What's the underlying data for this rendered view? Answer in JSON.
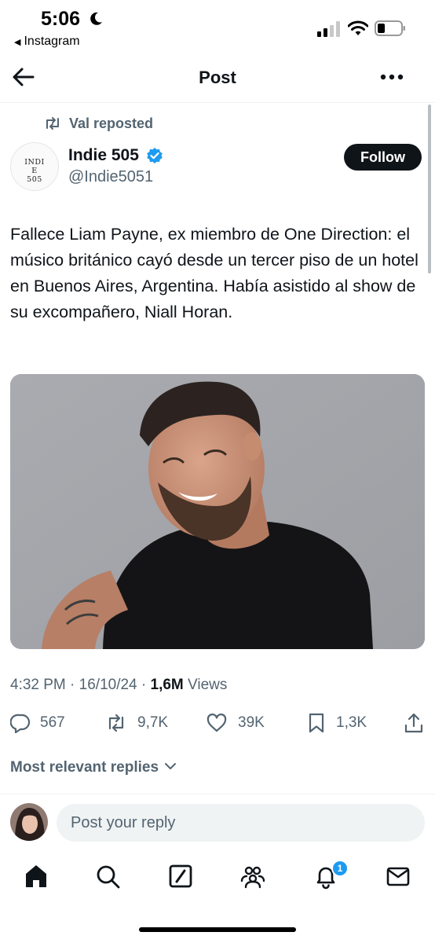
{
  "status_bar": {
    "time": "5:06",
    "back_app": "Instagram"
  },
  "header": {
    "title": "Post"
  },
  "repost": {
    "text": "Val reposted"
  },
  "author": {
    "avatar_logo_text": "INDIE 505",
    "name": "Indie 505",
    "handle": "@Indie5051",
    "follow_label": "Follow"
  },
  "tweet": {
    "text": "Fallece Liam Payne, ex miembro de One Direction: el músico británico cayó desde un tercer piso de un hotel en Buenos Aires, Argentina. Había asistido al show de su excompañero, Niall Horan."
  },
  "meta": {
    "time": "4:32 PM",
    "date": "16/10/24",
    "views_count": "1,6M",
    "views_label": "Views"
  },
  "actions": {
    "replies": "567",
    "reposts": "9,7K",
    "likes": "39K",
    "bookmarks": "1,3K"
  },
  "replies_sort": "Most relevant replies",
  "composer": {
    "placeholder": "Post your reply"
  },
  "tabbar": {
    "notifications_badge": "1"
  },
  "colors": {
    "accent": "#1d9bf0",
    "text_primary": "#0f1419",
    "text_secondary": "#536471",
    "follow_bg": "#0f1419",
    "input_bg": "#eff3f4"
  },
  "icons": [
    "moon-icon",
    "cellular-signal-icon",
    "wifi-icon",
    "battery-icon",
    "back-arrow-icon",
    "more-icon",
    "repost-icon",
    "verified-badge-icon",
    "reply-icon",
    "like-icon",
    "bookmark-icon",
    "share-icon",
    "chevron-down-icon",
    "home-icon",
    "search-icon",
    "grok-icon",
    "communities-icon",
    "bell-icon",
    "mail-icon"
  ]
}
